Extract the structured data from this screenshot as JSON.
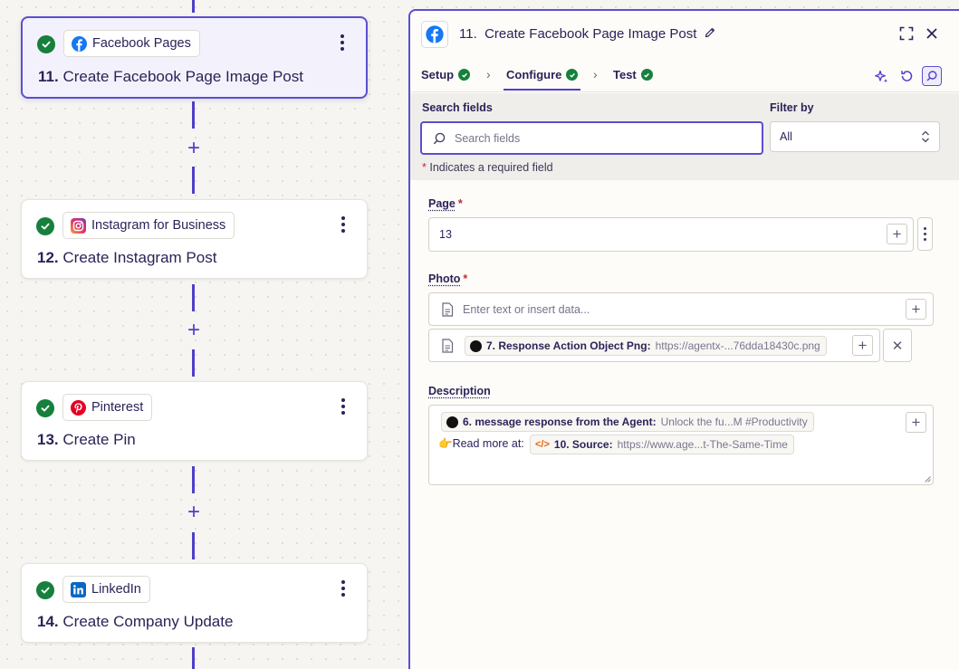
{
  "colors": {
    "accent": "#4f3fc9",
    "success": "#16803c",
    "facebook": "#1877f2",
    "instagram": "#e1306c",
    "pinterest": "#e60023",
    "linkedin": "#0a66c2",
    "required": "#c62a2a"
  },
  "steps": [
    {
      "app": "Facebook Pages",
      "number": "11.",
      "title": "Create Facebook Page Image Post",
      "icon": "facebook-icon",
      "selected": true
    },
    {
      "app": "Instagram for Business",
      "number": "12.",
      "title": "Create Instagram Post",
      "icon": "instagram-icon"
    },
    {
      "app": "Pinterest",
      "number": "13.",
      "title": "Create Pin",
      "icon": "pinterest-icon"
    },
    {
      "app": "LinkedIn",
      "number": "14.",
      "title": "Create Company Update",
      "icon": "linkedin-icon"
    }
  ],
  "add_step_symbol": "+",
  "panel": {
    "number": "11.",
    "title": "Create Facebook Page Image Post",
    "tabs": [
      {
        "label": "Setup",
        "status": "complete"
      },
      {
        "label": "Configure",
        "status": "complete",
        "active": true
      },
      {
        "label": "Test",
        "status": "complete"
      }
    ],
    "search": {
      "label": "Search fields",
      "placeholder": "Search fields",
      "filter_label": "Filter by",
      "filter_value": "All"
    },
    "required_note": {
      "star": "*",
      "text": "Indicates a required field"
    },
    "fields": {
      "page": {
        "label": "Page",
        "required": true,
        "value": "13"
      },
      "photo": {
        "label": "Photo",
        "required": true,
        "placeholder": "Enter text or insert data...",
        "pill_label": "7. Response Action Object Png:",
        "pill_value": "https://agentx-...76dda18430c.png"
      },
      "description": {
        "label": "Description",
        "pill1_label": "6. message response from the Agent:",
        "pill1_value": "Unlock the fu...M #Productivity",
        "read_more_emoji": "👉",
        "read_more_text": "Read more at:",
        "pill2_label": "10. Source:",
        "pill2_value": "https://www.age...t-The-Same-Time"
      }
    }
  }
}
